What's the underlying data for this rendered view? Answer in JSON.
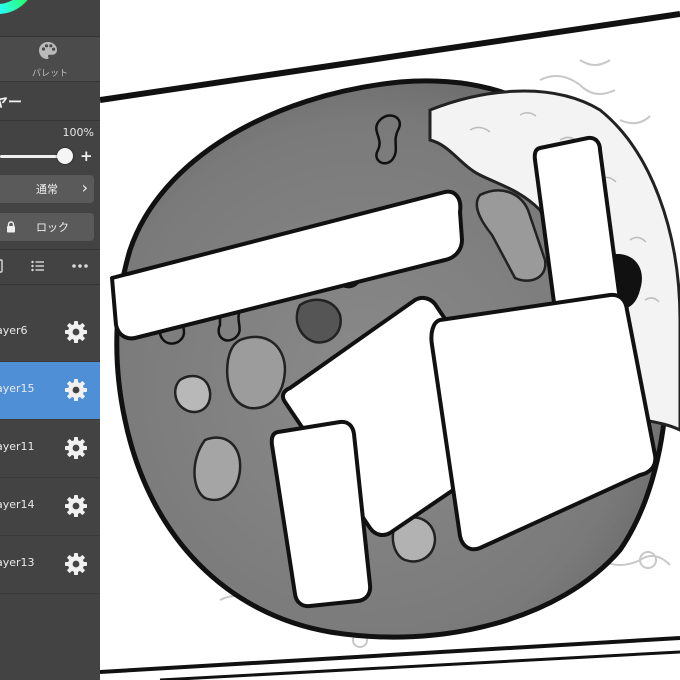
{
  "palette_tab": {
    "label": "パレット",
    "icon": "palette-icon"
  },
  "layer_panel": {
    "title": "ヤー",
    "opacity": {
      "value_label": "100%",
      "percent": 100,
      "plus": "+"
    },
    "blend_mode": {
      "label": "通常",
      "chevron": "›"
    },
    "lock": {
      "label": "ロック",
      "icon": "lock-icon"
    },
    "toolbar": [
      "layer-add-icon",
      "list-icon",
      "more-icon"
    ],
    "layers": [
      {
        "name": "ayer6",
        "selected": false
      },
      {
        "name": "ayer15",
        "selected": true
      },
      {
        "name": "ayer11",
        "selected": false
      },
      {
        "name": "ayer14",
        "selected": false
      },
      {
        "name": "ayer13",
        "selected": false
      }
    ]
  },
  "colors": {
    "panel": "#434343",
    "selected_row": "#4f8fd6",
    "canvas": "#ffffff"
  }
}
